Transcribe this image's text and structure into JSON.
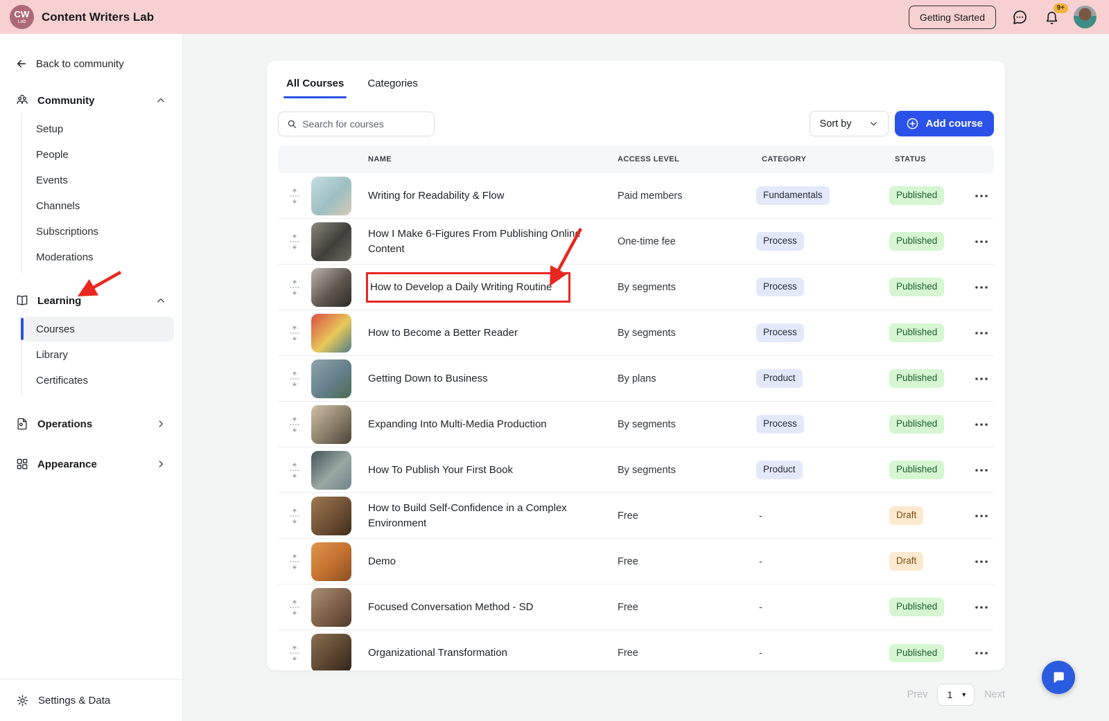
{
  "header": {
    "logo_line1": "CW",
    "logo_line2": "Lab",
    "title": "Content Writers Lab",
    "getting_started_label": "Getting Started",
    "notification_count": "9+"
  },
  "sidebar": {
    "back_label": "Back to community",
    "sections": [
      {
        "label": "Community",
        "icon": "community-icon",
        "state": "expanded",
        "items": [
          "Setup",
          "People",
          "Events",
          "Channels",
          "Subscriptions",
          "Moderations"
        ],
        "active_item": null
      },
      {
        "label": "Learning",
        "icon": "learning-icon",
        "state": "expanded",
        "items": [
          "Courses",
          "Library",
          "Certificates"
        ],
        "active_item": "Courses"
      },
      {
        "label": "Operations",
        "icon": "operations-icon",
        "state": "collapsed",
        "items": [],
        "active_item": null
      },
      {
        "label": "Appearance",
        "icon": "appearance-icon",
        "state": "collapsed",
        "items": [],
        "active_item": null
      }
    ],
    "footer_label": "Settings & Data"
  },
  "main": {
    "tabs": [
      {
        "label": "All Courses",
        "active": true
      },
      {
        "label": "Categories",
        "active": false
      }
    ],
    "search_placeholder": "Search for courses",
    "sort_label": "Sort by",
    "add_course_label": "Add course",
    "table": {
      "columns": [
        "NAME",
        "ACCESS LEVEL",
        "CATEGORY",
        "STATUS"
      ],
      "rows": [
        {
          "name": "Writing for Readability & Flow",
          "access": "Paid members",
          "category": "Fundamentals",
          "status": "Published",
          "highlighted": false,
          "thumb_colors": [
            "#c6dde0",
            "#9dbfc2",
            "#d9cbb8"
          ]
        },
        {
          "name": "How I Make 6-Figures From Publishing Online Content",
          "access": "One-time fee",
          "category": "Process",
          "status": "Published",
          "highlighted": false,
          "thumb_colors": [
            "#8c8a7e",
            "#3f3e3a",
            "#6b6a60"
          ]
        },
        {
          "name": "How to Develop a Daily Writing Routine",
          "access": "By segments",
          "category": "Process",
          "status": "Published",
          "highlighted": true,
          "thumb_colors": [
            "#b9b4ae",
            "#5f574e",
            "#2f2b28"
          ]
        },
        {
          "name": "How to Become a Better Reader",
          "access": "By segments",
          "category": "Process",
          "status": "Published",
          "highlighted": false,
          "thumb_colors": [
            "#d94f43",
            "#e8c85a",
            "#4f7f86"
          ]
        },
        {
          "name": "Getting Down to Business",
          "access": "By plans",
          "category": "Product",
          "status": "Published",
          "highlighted": false,
          "thumb_colors": [
            "#8fa3ab",
            "#64808a",
            "#4f6b52"
          ]
        },
        {
          "name": "Expanding Into Multi-Media Production",
          "access": "By segments",
          "category": "Process",
          "status": "Published",
          "highlighted": false,
          "thumb_colors": [
            "#cfc0a8",
            "#8a7d68",
            "#4a443a"
          ]
        },
        {
          "name": "How To Publish Your First Book",
          "access": "By segments",
          "category": "Product",
          "status": "Published",
          "highlighted": false,
          "thumb_colors": [
            "#44555a",
            "#9aa8a2",
            "#70848c"
          ]
        },
        {
          "name": "How to Build Self-Confidence in a Complex Environment",
          "access": "Free",
          "category": "-",
          "status": "Draft",
          "highlighted": false,
          "thumb_colors": [
            "#9c7a52",
            "#6e4f33",
            "#3f2d1c"
          ]
        },
        {
          "name": "Demo",
          "access": "Free",
          "category": "-",
          "status": "Draft",
          "highlighted": false,
          "thumb_colors": [
            "#e0964a",
            "#c2702f",
            "#8a4f22"
          ]
        },
        {
          "name": "Focused Conversation Method - SD",
          "access": "Free",
          "category": "-",
          "status": "Published",
          "highlighted": false,
          "thumb_colors": [
            "#a98e74",
            "#7d5f48",
            "#50392a"
          ]
        },
        {
          "name": "Organizational Transformation",
          "access": "Free",
          "category": "-",
          "status": "Published",
          "highlighted": false,
          "thumb_colors": [
            "#8a7154",
            "#5c452f",
            "#2f2318"
          ]
        }
      ]
    },
    "pagination": {
      "prev_label": "Prev",
      "page_value": "1",
      "next_label": "Next"
    }
  },
  "colors": {
    "accent_blue": "#2b52e8",
    "header_pink": "#f7d1d1",
    "logo_bg": "#ad6977",
    "annotation_red": "#e8271f",
    "category_badge_bg": "#e4e8fb",
    "published_badge_bg": "#d5f6d1",
    "draft_badge_bg": "#fce9cf",
    "notification_badge_bg": "#f2b33d",
    "chat_widget_bg": "#2b5ce0"
  }
}
